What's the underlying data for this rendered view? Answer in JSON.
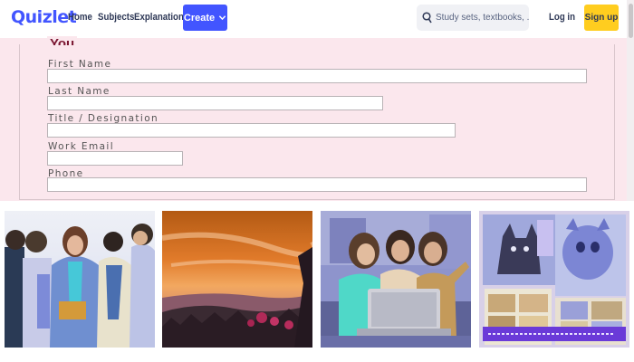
{
  "header": {
    "logo": "Quizlet",
    "nav": [
      "Home",
      "Subjects",
      "Explanations"
    ],
    "create_label": "Create",
    "search_placeholder": "Study sets, textbooks, ...",
    "login_label": "Log in",
    "signup_label": "Sign up"
  },
  "form": {
    "section_title": "You",
    "fields": [
      {
        "label": "First Name",
        "value": ""
      },
      {
        "label": "Last Name",
        "value": ""
      },
      {
        "label": "Title / Designation",
        "value": ""
      },
      {
        "label": "Work Email",
        "value": ""
      },
      {
        "label": "Phone",
        "value": ""
      }
    ]
  },
  "gallery": {
    "images": [
      {
        "name": "group-of-students-photo"
      },
      {
        "name": "sunset-landscape-photo"
      },
      {
        "name": "students-with-laptop-photo"
      },
      {
        "name": "pet-magazine-collage-photo"
      }
    ]
  },
  "colors": {
    "brand": "#4255ff",
    "signup": "#ffcd1f",
    "form_bg": "#fbe7ed",
    "title": "#7a1631"
  }
}
